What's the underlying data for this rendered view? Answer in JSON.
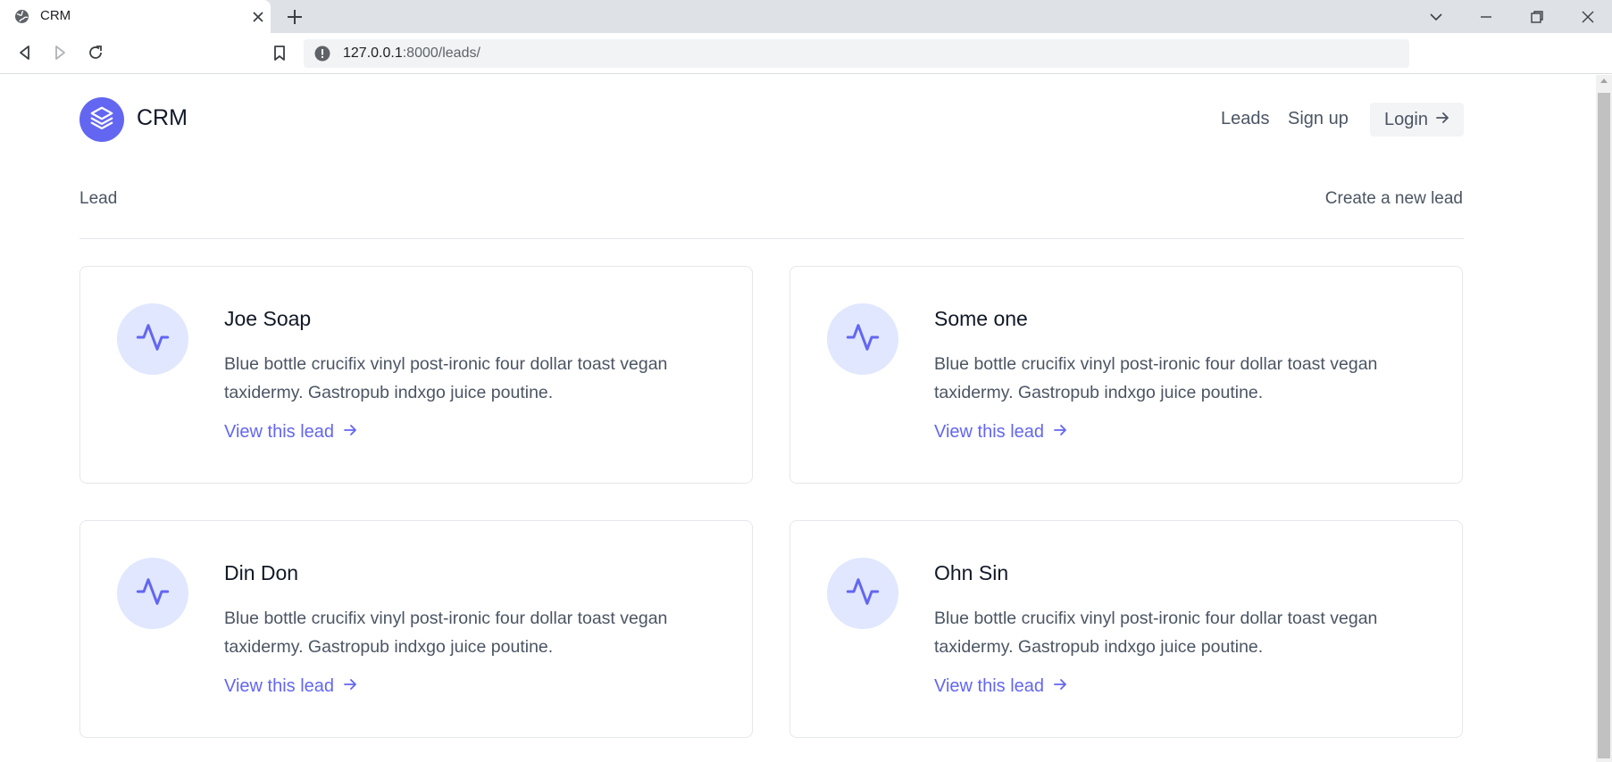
{
  "browser": {
    "tab_title": "CRM",
    "url_host": "127.0.0.1",
    "url_rest": ":8000/leads/"
  },
  "header": {
    "brand": "CRM",
    "nav": {
      "leads": "Leads",
      "signup": "Sign up",
      "login": "Login"
    }
  },
  "page": {
    "section_title": "Lead",
    "create_link": "Create a new lead"
  },
  "leads": [
    {
      "name": "Joe Soap",
      "description": "Blue bottle crucifix vinyl post-ironic four dollar toast vegan taxidermy. Gastropub indxgo juice poutine.",
      "link": "View this lead"
    },
    {
      "name": "Some one",
      "description": "Blue bottle crucifix vinyl post-ironic four dollar toast vegan taxidermy. Gastropub indxgo juice poutine.",
      "link": "View this lead"
    },
    {
      "name": "Din Don",
      "description": "Blue bottle crucifix vinyl post-ironic four dollar toast vegan taxidermy. Gastropub indxgo juice poutine.",
      "link": "View this lead"
    },
    {
      "name": "Ohn Sin",
      "description": "Blue bottle crucifix vinyl post-ironic four dollar toast vegan taxidermy. Gastropub indxgo juice poutine.",
      "link": "View this lead"
    }
  ],
  "colors": {
    "accent": "#6366f1",
    "icon_bg": "#e0e7ff",
    "text_muted": "#4b5563",
    "chrome_bg": "#dee1e6"
  },
  "icons": {
    "logo": "stack-layers-icon",
    "lead": "activity-pulse-icon",
    "arrow": "arrow-right-icon"
  }
}
